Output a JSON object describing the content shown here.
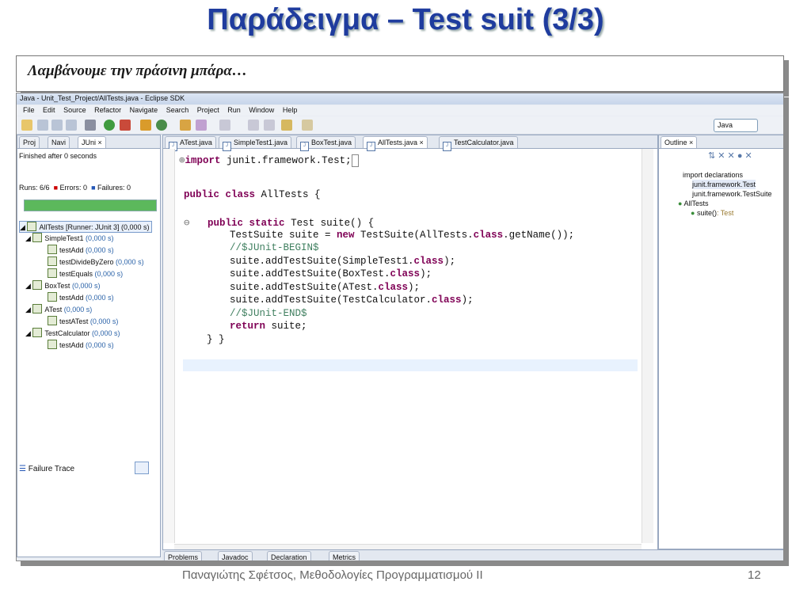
{
  "slide": {
    "title": "Παράδειγμα – Test suit  (3/3)",
    "caption": "Λαμβάνουμε την πράσινη μπάρα…",
    "footer_author": "Παναγιώτης Σφέτσος,  Μεθοδολογίες Προγραμματισμού ΙΙ",
    "page_number": "12"
  },
  "window": {
    "title": "Java - Unit_Test_Project/AllTests.java - Eclipse SDK",
    "menu": [
      "File",
      "Edit",
      "Source",
      "Refactor",
      "Navigate",
      "Search",
      "Project",
      "Run",
      "Window",
      "Help"
    ],
    "perspective": "Java"
  },
  "left_panel": {
    "tabs": [
      "Proj",
      "Navi",
      "JUni"
    ],
    "status": "Finished after 0 seconds",
    "runs_label": "Runs:",
    "runs_value": "6/6",
    "errors_label": "Errors:",
    "errors_value": "0",
    "failures_label": "Failures:",
    "failures_value": "0",
    "bar_color": "#5cb85c",
    "progress": 1.0,
    "tree": [
      {
        "label": "AllTests [Runner: JUnit 3] (0,000 s)",
        "time": ""
      },
      {
        "label": "SimpleTest1",
        "time": "(0,000 s)"
      },
      {
        "label": "testAdd",
        "time": "(0,000 s)"
      },
      {
        "label": "testDivideByZero",
        "time": "(0,000 s)"
      },
      {
        "label": "testEquals",
        "time": "(0,000 s)"
      },
      {
        "label": "BoxTest",
        "time": "(0,000 s)"
      },
      {
        "label": "testAdd",
        "time": "(0,000 s)"
      },
      {
        "label": "ATest",
        "time": "(0,000 s)"
      },
      {
        "label": "testATest",
        "time": "(0,000 s)"
      },
      {
        "label": "TestCalculator",
        "time": "(0,000 s)"
      },
      {
        "label": "testAdd",
        "time": "(0,000 s)"
      }
    ],
    "failure_trace": "Failure Trace"
  },
  "editor": {
    "tabs": [
      "ATest.java",
      "SimpleTest1.java",
      "BoxTest.java",
      "AllTests.java",
      "TestCalculator.java"
    ],
    "lines": {
      "l1_kw": "import",
      "l1_rest": " junit.framework.Test;",
      "l3_kw": "public class",
      "l3_rest": " AllTests {",
      "l5_kw": "public static",
      "l5_rest": " Test suite() {",
      "l6_a": "TestSuite suite = ",
      "l6_kw": "new",
      "l6_b": " TestSuite(AllTests.",
      "l6_kw2": "class",
      "l6_c": ".getName());",
      "l7": "//$JUnit-BEGIN$",
      "l8_a": "suite.addTestSuite(SimpleTest1.",
      "l9_a": "suite.addTestSuite(BoxTest.",
      "l10_a": "suite.addTestSuite(ATest.",
      "l11_a": "suite.addTestSuite(TestCalculator.",
      "class_kw": "class",
      "close": ");",
      "l12": "//$JUnit-END$",
      "l13_kw": "return",
      "l13_rest": " suite;",
      "l14": "} }"
    }
  },
  "bottom_tabs": [
    "Problems",
    "Javadoc",
    "Declaration",
    "Metrics"
  ],
  "outline": {
    "tab": "Outline",
    "items": [
      "import declarations",
      "junit.framework.Test",
      "junit.framework.TestSuite",
      "AllTests",
      "suite()",
      ": Test"
    ]
  }
}
